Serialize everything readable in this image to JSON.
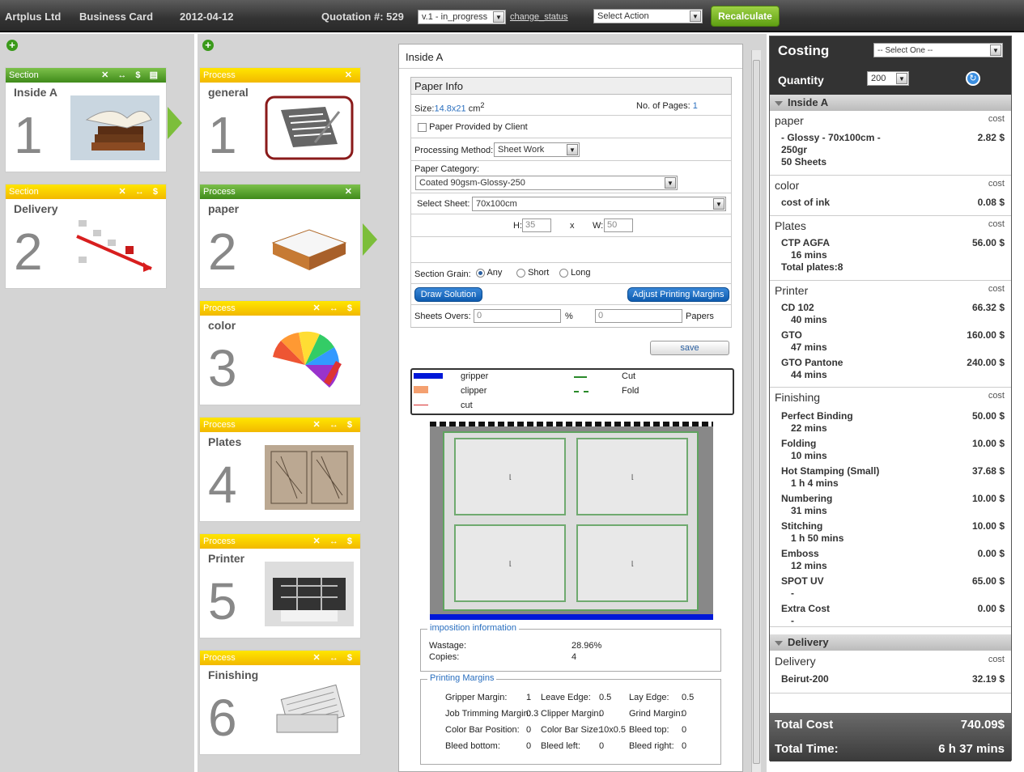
{
  "topbar": {
    "company": "Artplus Ltd",
    "product": "Business Card",
    "date": "2012-04-12",
    "quotation_label": "Quotation #: 529",
    "version": "v.1 - in_progress",
    "change_status": "change_status",
    "action_placeholder": "Select Action",
    "recalculate": "Recalculate"
  },
  "sections": [
    {
      "header": "Section",
      "name": "Inside A",
      "number": "1",
      "controls": "✕ ↔ $ ▤",
      "color": "#4f9a2a",
      "image": "books-image"
    },
    {
      "header": "Section",
      "name": "Delivery",
      "number": "2",
      "controls": "✕ ↔ $",
      "color": "#f2c200",
      "image": "chart-image"
    }
  ],
  "processes": [
    {
      "header": "Process",
      "name": "general",
      "number": "1",
      "controls": "✕",
      "color": "#f2c200",
      "image": "document-icon"
    },
    {
      "header": "Process",
      "name": "paper",
      "number": "2",
      "controls": "✕",
      "color": "#4f9a2a",
      "image": "paper-tray-image"
    },
    {
      "header": "Process",
      "name": "color",
      "number": "3",
      "controls": "✕ ↔ $",
      "color": "#f2c200",
      "image": "color-swatch-image"
    },
    {
      "header": "Process",
      "name": "Plates",
      "number": "4",
      "controls": "✕ ↔ $",
      "color": "#f2c200",
      "image": "plate-image"
    },
    {
      "header": "Process",
      "name": "Printer",
      "number": "5",
      "controls": "✕ ↔ $",
      "color": "#f2c200",
      "image": "printer-image"
    },
    {
      "header": "Process",
      "name": "Finishing",
      "number": "6",
      "controls": "✕ ↔ $",
      "color": "#f2c200",
      "image": "newspaper-image"
    }
  ],
  "main": {
    "title": "Inside A",
    "paper_info": "Paper Info",
    "size_label": "Size:",
    "size_value": "14.8x21",
    "size_unit": "cm",
    "size_sup": "2",
    "pages_label": "No. of Pages:",
    "pages_value": "1",
    "provided_by_client": "Paper Provided by Client",
    "processing_method_label": "Processing Method:",
    "processing_method": "Sheet Work",
    "paper_category_label": "Paper Category:",
    "paper_category": "Coated 90gsm-Glossy-250",
    "select_sheet_label": "Select Sheet:",
    "select_sheet": "70x100cm",
    "h_label": "H:",
    "h_value": "35",
    "x_label": "x",
    "w_label": "W:",
    "w_value": "50",
    "grain_label": "Section Grain:",
    "grain_any": "Any",
    "grain_short": "Short",
    "grain_long": "Long",
    "draw_solution": "Draw Solution",
    "adjust_margins": "Adjust Printing Margins",
    "sheets_overs_label": "Sheets Overs:",
    "sheets_overs_value": "0",
    "percent": "%",
    "papers_value": "0",
    "papers_label": "Papers",
    "save": "save"
  },
  "legend": {
    "gripper": "gripper",
    "clipper": "clipper",
    "cut_red": "cut",
    "cut": "Cut",
    "fold": "Fold",
    "colors": {
      "gripper": "#0018d8",
      "clipper": "#f4a070",
      "cut_red": "#d83030",
      "cut": "#2a8a2a",
      "fold": "#2a8a2a"
    }
  },
  "imposition": {
    "title": "imposition information",
    "wastage_label": "Wastage:",
    "wastage": "28.96%",
    "copies_label": "Copies:",
    "copies": "4"
  },
  "margins": {
    "title": "Printing Margins",
    "gripper_label": "Gripper Margin:",
    "gripper": "1",
    "leave_label": "Leave Edge:",
    "leave": "0.5",
    "lay_label": "Lay Edge:",
    "lay": "0.5",
    "trim_label": "Job Trimming Margin:",
    "trim": "0.3",
    "clipper_label": "Clipper Margin:",
    "clipper": "0",
    "grind_label": "Grind Margin:",
    "grind": "0",
    "cbpos_label": "Color Bar Position:",
    "cbpos": "0",
    "cbsize_label": "Color Bar Size:",
    "cbsize": "10x0.5",
    "bleedtop_label": "Bleed top:",
    "bleedtop": "0",
    "bleedbot_label": "Bleed bottom:",
    "bleedbot": "0",
    "bleedleft_label": "Bleed left:",
    "bleedleft": "0",
    "bleedright_label": "Bleed right:",
    "bleedright": "0"
  },
  "costing": {
    "title": "Costing",
    "select_one": "-- Select One --",
    "quantity_label": "Quantity",
    "quantity": "200",
    "section1": "Inside A",
    "section2": "Delivery",
    "cost_label": "cost",
    "paper": {
      "title": "paper",
      "line1": "- Glossy - 70x100cm -",
      "line2": "250gr",
      "line3": "50 Sheets",
      "value": "2.82 $"
    },
    "color": {
      "title": "color",
      "line1": "cost of ink",
      "value": "0.08 $"
    },
    "plates": {
      "title": "Plates",
      "line1": "CTP AGFA",
      "line2": "16 mins",
      "line3": "Total plates:8",
      "value": "56.00 $"
    },
    "printer": {
      "title": "Printer",
      "items": [
        {
          "name": "CD 102",
          "time": "40 mins",
          "value": "66.32 $"
        },
        {
          "name": "GTO",
          "time": "47 mins",
          "value": "160.00 $"
        },
        {
          "name": "GTO Pantone",
          "time": "44 mins",
          "value": "240.00 $"
        }
      ]
    },
    "finishing": {
      "title": "Finishing",
      "items": [
        {
          "name": "Perfect Binding",
          "time": "22 mins",
          "value": "50.00 $"
        },
        {
          "name": "Folding",
          "time": "10 mins",
          "value": "10.00 $"
        },
        {
          "name": "Hot Stamping (Small)",
          "time": "1 h 4 mins",
          "value": "37.68 $"
        },
        {
          "name": "Numbering",
          "time": "31 mins",
          "value": "10.00 $"
        },
        {
          "name": "Stitching",
          "time": "1 h 50 mins",
          "value": "10.00 $"
        },
        {
          "name": "Emboss",
          "time": "12 mins",
          "value": "0.00 $"
        },
        {
          "name": "SPOT UV",
          "time": "-",
          "value": "65.00 $"
        },
        {
          "name": "Extra Cost",
          "time": "-",
          "value": "0.00 $"
        }
      ]
    },
    "delivery": {
      "title": "Delivery",
      "line1": "Beirut-200",
      "value": "32.19 $"
    },
    "total_cost_label": "Total Cost",
    "total_cost": "740.09$",
    "total_time_label": "Total Time:",
    "total_time": "6 h 37 mins"
  }
}
